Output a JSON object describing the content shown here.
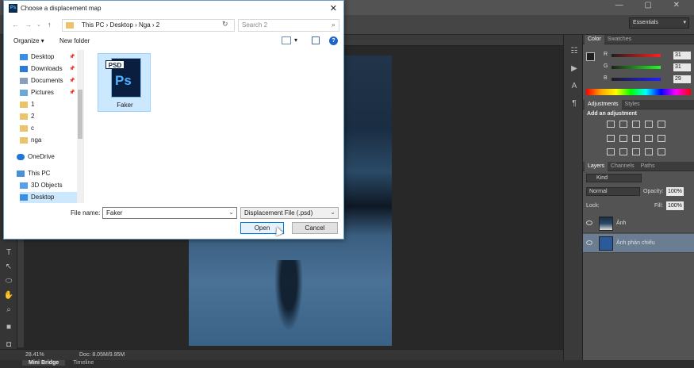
{
  "photoshop": {
    "workspace": "Essentials",
    "status": {
      "zoom": "28.41%",
      "doc": "Doc: 8.05M/9.95M"
    },
    "bottom_tabs": [
      "Mini Bridge",
      "Timeline"
    ],
    "color_panel": {
      "tabs": [
        "Color",
        "Swatches"
      ],
      "r_label": "R",
      "g_label": "G",
      "b_label": "B",
      "r": "31",
      "g": "31",
      "b": "29"
    },
    "adjustments_panel": {
      "tabs": [
        "Adjustments",
        "Styles"
      ],
      "heading": "Add an adjustment"
    },
    "layers_panel": {
      "tabs": [
        "Layers",
        "Channels",
        "Paths"
      ],
      "filter": "Kind",
      "blend_mode": "Normal",
      "opacity_label": "Opacity:",
      "opacity": "100%",
      "lock_label": "Lock:",
      "fill_label": "Fill:",
      "fill": "100%",
      "layers": [
        "Ảnh",
        "Ảnh phản chiếu"
      ]
    }
  },
  "dialog": {
    "title": "Choose a displacement map",
    "address": "This PC  ›  Desktop  ›  Nga  ›  2",
    "search_placeholder": "Search 2",
    "organize": "Organize ▾",
    "new_folder": "New folder",
    "nav_items": [
      "Desktop",
      "Downloads",
      "Documents",
      "Pictures",
      "1",
      "2",
      "c",
      "nga",
      "OneDrive",
      "This PC",
      "3D Objects",
      "Desktop"
    ],
    "file": {
      "name": "Faker",
      "tag": "PSD",
      "logo": "Ps"
    },
    "file_name_label": "File name:",
    "file_name_value": "Faker",
    "file_type": "Displacement File (.psd)",
    "open_label": "Open",
    "cancel_label": "Cancel"
  }
}
